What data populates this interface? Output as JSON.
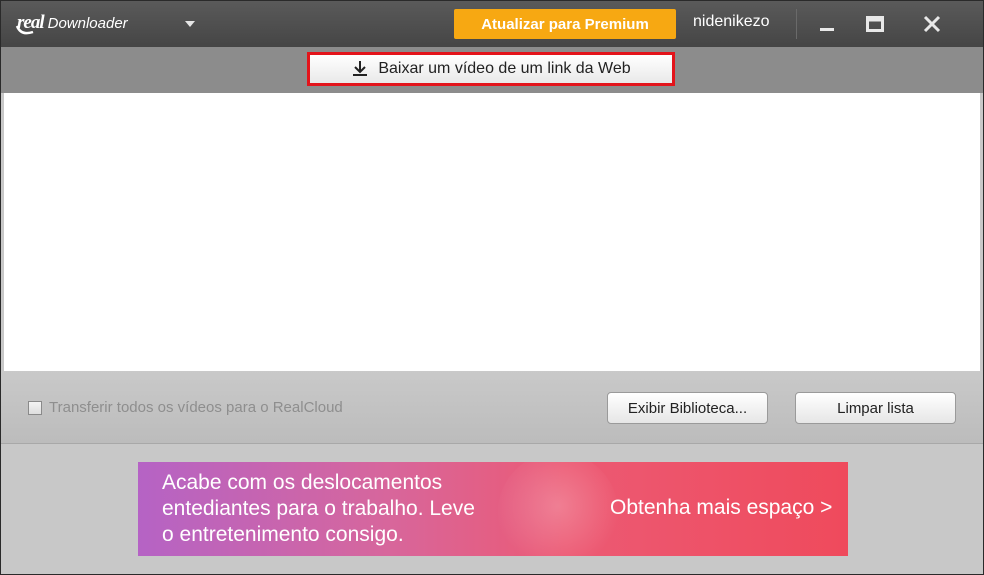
{
  "app": {
    "logo_brand": "real",
    "logo_product": "Downloader",
    "premium_button": "Atualizar para Premium",
    "username": "nidenikezo"
  },
  "toolbar": {
    "download_link_button": "Baixar um vídeo de um link da Web"
  },
  "controls": {
    "transfer_checkbox_label": "Transferir todos os vídeos para o RealCloud",
    "transfer_checked": false,
    "library_button": "Exibir Biblioteca...",
    "clear_button": "Limpar lista"
  },
  "banner": {
    "line1": "Acabe com os deslocamentos",
    "line2": "entediantes para o trabalho. Leve",
    "line3": "o entretenimento consigo.",
    "cta": "Obtenha mais espaço >"
  },
  "colors": {
    "premium": "#f7a812",
    "highlight_border": "#e3141b",
    "titlebar": "#4e4e4e"
  }
}
